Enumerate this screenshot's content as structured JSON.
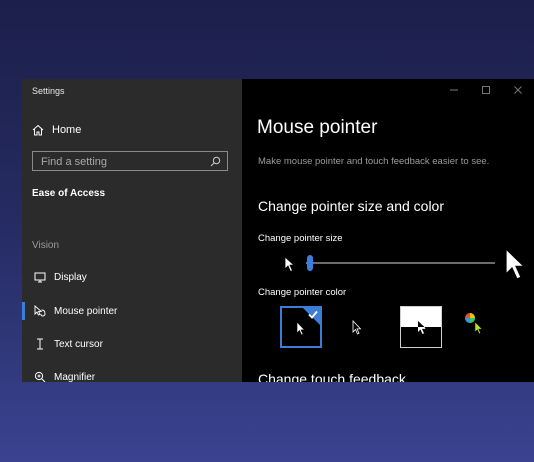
{
  "window": {
    "title": "Settings",
    "caption_buttons": [
      "minimize",
      "maximize",
      "close"
    ]
  },
  "sidebar": {
    "home_label": "Home",
    "search_placeholder": "Find a setting",
    "section": "Ease of Access",
    "group": "Vision",
    "items": [
      {
        "label": "Display",
        "icon": "monitor-icon",
        "selected": false
      },
      {
        "label": "Mouse pointer",
        "icon": "mouse-pointer-icon",
        "selected": true
      },
      {
        "label": "Text cursor",
        "icon": "text-cursor-icon",
        "selected": false
      },
      {
        "label": "Magnifier",
        "icon": "magnifier-icon",
        "selected": false
      }
    ]
  },
  "main": {
    "title": "Mouse pointer",
    "description": "Make mouse pointer and touch feedback easier to see.",
    "size_section_title": "Change pointer size and color",
    "size_label": "Change pointer size",
    "size_level": 0.02,
    "color_label": "Change pointer color",
    "color_options": [
      {
        "name": "white",
        "selected": true
      },
      {
        "name": "black",
        "selected": false
      },
      {
        "name": "inverted",
        "selected": false
      },
      {
        "name": "custom",
        "selected": false
      }
    ],
    "touch_title": "Change touch feedback"
  },
  "colors": {
    "accent": "#3b7dd8",
    "sidebar_bg": "#2b2b2b",
    "main_bg": "#000000"
  }
}
